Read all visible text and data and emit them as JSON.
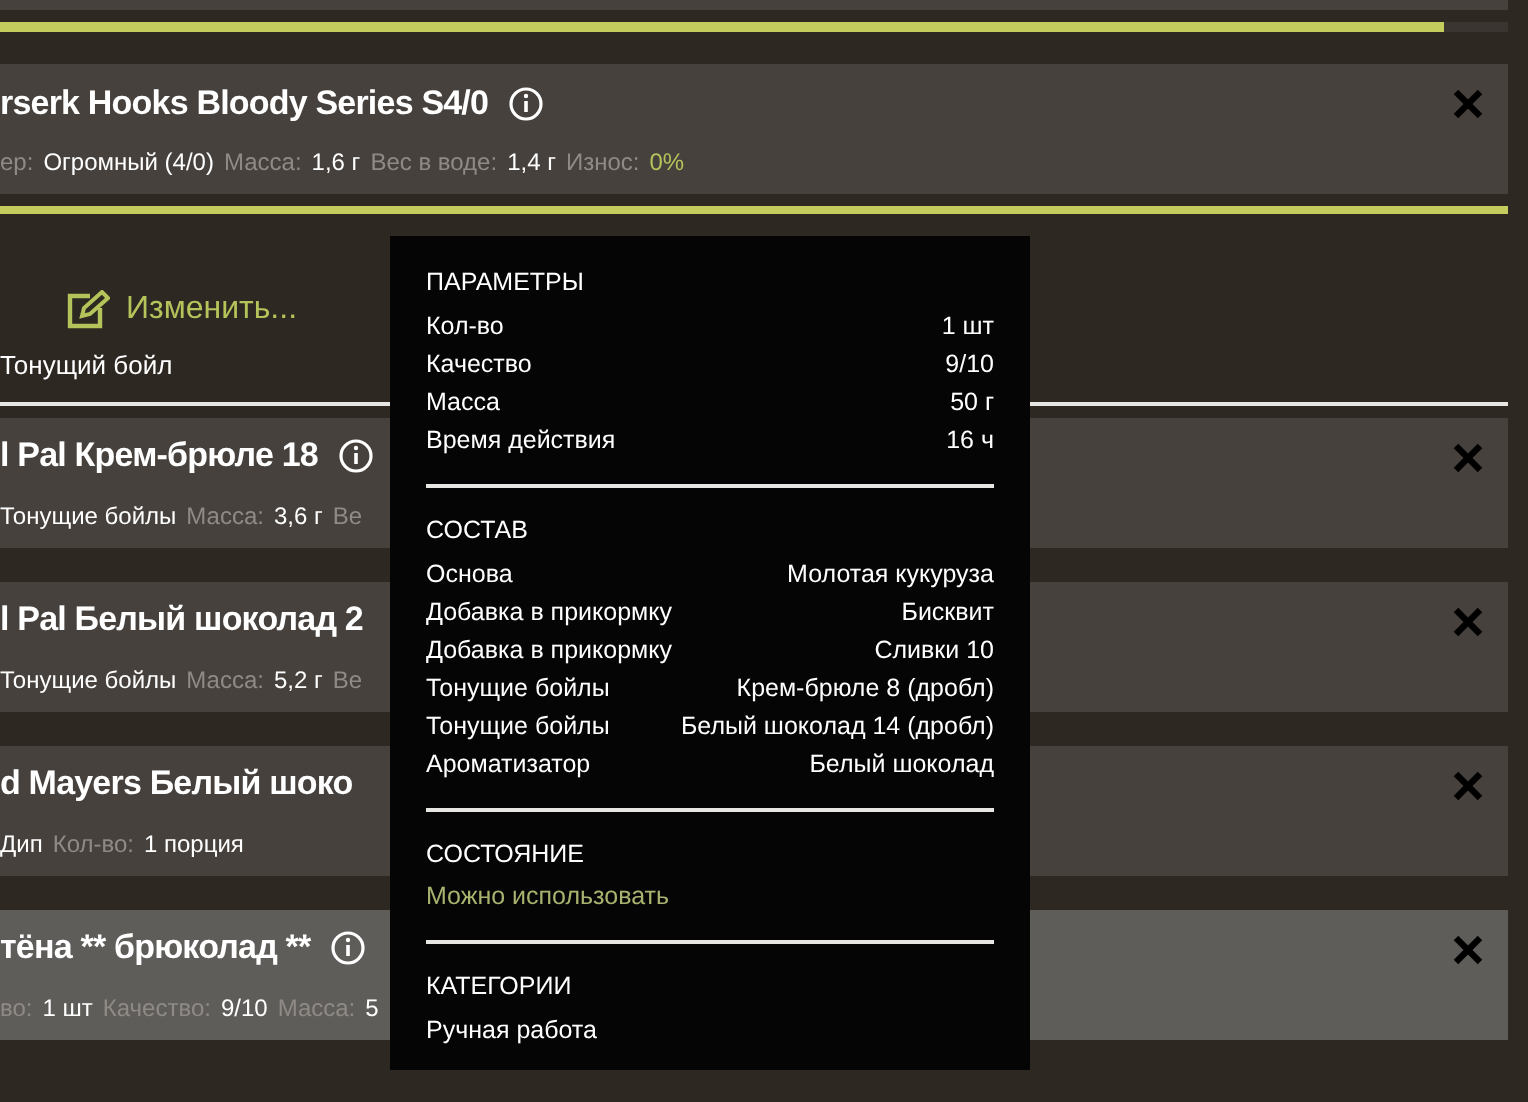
{
  "top_bar": {
    "level": 0.957
  },
  "equipped": {
    "title": "rserk Hooks Bloody Series S4/0",
    "info": true,
    "meta": [
      {
        "text": "ер:",
        "kind": "label"
      },
      {
        "text": "Огромный (4/0)",
        "kind": "value"
      },
      {
        "text": "Масса:",
        "kind": "label"
      },
      {
        "text": "1,6 г",
        "kind": "value"
      },
      {
        "text": "Вес в воде:",
        "kind": "label"
      },
      {
        "text": "1,4 г",
        "kind": "value"
      },
      {
        "text": "Износ:",
        "kind": "label"
      },
      {
        "text": "0%",
        "kind": "accent"
      }
    ]
  },
  "edit_button": {
    "label": "Изменить..."
  },
  "slot_type": "Тонущий бойл",
  "cards": [
    {
      "title": "l Pal Крем-брюле 18",
      "info": true,
      "selected": false,
      "meta": [
        {
          "text": "Тонущие бойлы",
          "kind": "value"
        },
        {
          "text": "Масса:",
          "kind": "label"
        },
        {
          "text": "3,6 г",
          "kind": "value"
        },
        {
          "text": "Ве",
          "kind": "label"
        }
      ]
    },
    {
      "title": "l Pal Белый шоколад 2",
      "info": false,
      "selected": false,
      "meta": [
        {
          "text": "Тонущие бойлы",
          "kind": "value"
        },
        {
          "text": "Масса:",
          "kind": "label"
        },
        {
          "text": "5,2 г",
          "kind": "value"
        },
        {
          "text": "Ве",
          "kind": "label"
        }
      ]
    },
    {
      "title": "d Mayers Белый шоко",
      "info": false,
      "selected": false,
      "meta": [
        {
          "text": "Дип",
          "kind": "value"
        },
        {
          "text": "Кол-во:",
          "kind": "label"
        },
        {
          "text": "1 порция",
          "kind": "value"
        }
      ]
    },
    {
      "title": "тёна ** брюколад **",
      "info": true,
      "selected": true,
      "meta": [
        {
          "text": "во:",
          "kind": "label"
        },
        {
          "text": "1 шт",
          "kind": "value"
        },
        {
          "text": "Качество:",
          "kind": "label"
        },
        {
          "text": "9/10",
          "kind": "value"
        },
        {
          "text": "Масса:",
          "kind": "label"
        },
        {
          "text": "5",
          "kind": "value"
        }
      ]
    }
  ],
  "tooltip": {
    "sections": [
      {
        "heading": "ПАРАМЕТРЫ",
        "kind": "rows",
        "rows": [
          {
            "label": "Кол-во",
            "value": "1 шт"
          },
          {
            "label": "Качество",
            "value": "9/10"
          },
          {
            "label": "Масса",
            "value": "50 г"
          },
          {
            "label": "Время действия",
            "value": "16 ч"
          }
        ]
      },
      {
        "heading": "СОСТАВ",
        "kind": "rows",
        "rows": [
          {
            "label": "Основа",
            "value": "Молотая кукуруза"
          },
          {
            "label": "Добавка в прикормку",
            "value": "Бисквит"
          },
          {
            "label": "Добавка в прикормку",
            "value": "Сливки 10"
          },
          {
            "label": "Тонущие бойлы",
            "value": "Крем-брюле 8 (дробл)"
          },
          {
            "label": "Тонущие бойлы",
            "value": "Белый шоколад 14 (дробл)"
          },
          {
            "label": "Ароматизатор",
            "value": "Белый шоколад"
          }
        ]
      },
      {
        "heading": "СОСТОЯНИЕ",
        "kind": "status",
        "text": "Можно использовать"
      },
      {
        "heading": "КАТЕГОРИИ",
        "kind": "text",
        "text": "Ручная работа"
      }
    ]
  }
}
